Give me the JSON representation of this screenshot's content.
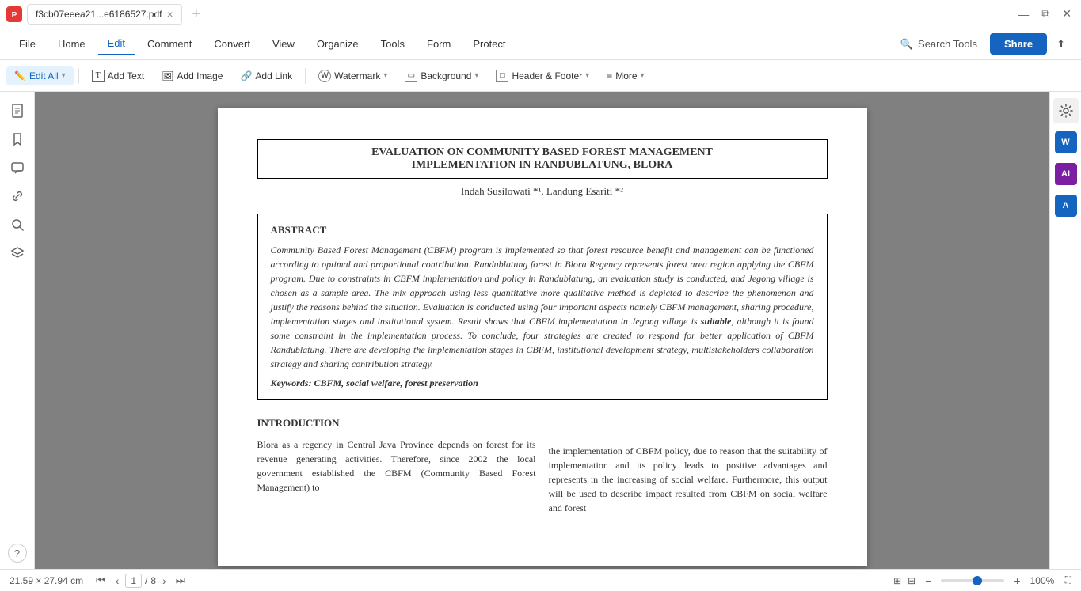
{
  "titlebar": {
    "filename": "f3cb07eeea21...e6186527.pdf",
    "new_tab_label": "+",
    "close_label": "×"
  },
  "menubar": {
    "items": [
      {
        "label": "File",
        "active": false
      },
      {
        "label": "Home",
        "active": false
      },
      {
        "label": "Edit",
        "active": true
      },
      {
        "label": "Comment",
        "active": false
      },
      {
        "label": "Convert",
        "active": false
      },
      {
        "label": "View",
        "active": false
      },
      {
        "label": "Organize",
        "active": false
      },
      {
        "label": "Tools",
        "active": false
      },
      {
        "label": "Form",
        "active": false
      },
      {
        "label": "Protect",
        "active": false
      }
    ],
    "search_placeholder": "Search Tools",
    "search_icon": "🔍",
    "share_label": "Share"
  },
  "toolbar": {
    "items": [
      {
        "label": "Edit All",
        "has_chevron": true,
        "icon": "✏️",
        "active": false
      },
      {
        "label": "Add Text",
        "icon": "T",
        "active": false
      },
      {
        "label": "Add Image",
        "icon": "🖼",
        "active": false
      },
      {
        "label": "Add Link",
        "icon": "🔗",
        "active": false
      },
      {
        "label": "Watermark",
        "has_chevron": true,
        "icon": "💧",
        "active": false
      },
      {
        "label": "Background",
        "has_chevron": true,
        "icon": "🖊",
        "active": false
      },
      {
        "label": "Header & Footer",
        "has_chevron": true,
        "icon": "▭",
        "active": false
      },
      {
        "label": "More",
        "has_chevron": true,
        "icon": "≡",
        "active": false
      }
    ]
  },
  "left_sidebar": {
    "icons": [
      {
        "name": "document-icon",
        "symbol": "📄"
      },
      {
        "name": "bookmark-icon",
        "symbol": "🔖"
      },
      {
        "name": "comment-icon",
        "symbol": "💬"
      },
      {
        "name": "link-icon",
        "symbol": "🔗"
      },
      {
        "name": "search-icon",
        "symbol": "🔍"
      },
      {
        "name": "layers-icon",
        "symbol": "⧉"
      }
    ],
    "bottom_icon": {
      "name": "help-icon",
      "symbol": "?"
    }
  },
  "right_sidebar": {
    "icons": [
      {
        "name": "word-icon",
        "color": "#1565c0"
      },
      {
        "name": "ai-icon",
        "color": "#7b1fa2"
      },
      {
        "name": "word2-icon",
        "color": "#1565c0"
      },
      {
        "name": "settings-icon",
        "color": "#555"
      }
    ]
  },
  "pdf": {
    "title_line1": "EVALUATION ON COMMUNITY BASED FOREST MANAGEMENT",
    "title_line2": "IMPLEMENTATION IN RANDUBLATUNG,  BLORA",
    "authors": "Indah Susilowati *¹, Landung Esariti *²",
    "abstract_title": "ABSTRACT",
    "abstract_text": "Community Based Forest Management (CBFM) program is implemented so that forest resource benefit and management can be functioned according to optimal and proportional contribution. Randublatung forest in Blora Regency represents forest area region applying the CBFM program. Due to constraints in CBFM implementation and policy in Randublatung, an evaluation study is conducted, and Jegong village is chosen as a sample area. The mix approach using less quantitative more qualitative method  is depicted to describe the phenomenon and justify the reasons behind the situation. Evaluation is conducted using four important aspects namely CBFM management, sharing procedure, implementation stages and institutional system. Result shows that CBFM implementation in Jegong village is suitable, although it is found some constraint in the implementation process. To conclude, four strategies are created to respond for better application of CBFM Randublatung. There are developing the implementation stages in CBFM, institutional development strategy, multistakeholders collaboration strategy and sharing contribution strategy.",
    "keywords_label": "Keywords:",
    "keywords_text": " CBFM, social welfare, forest preservation",
    "intro_title": "INTRODUCTION",
    "intro_col1": "    Blora as a regency in Central Java Province depends on forest for its revenue generating activities. Therefore, since 2002 the local government established the CBFM (Community Based Forest Management) to",
    "intro_col2": "the implementation of CBFM policy, due to reason that the suitability of implementation and its policy leads to positive advantages and represents in the increasing of social welfare. Furthermore, this output will be used to describe impact resulted from CBFM on social welfare and forest"
  },
  "bottombar": {
    "dimensions": "21.59 × 27.94 cm",
    "page_current": "1",
    "page_total": "8",
    "zoom_percent": "100%",
    "nav": {
      "first": "⏮",
      "prev": "‹",
      "next": "›",
      "last": "⏭"
    }
  }
}
